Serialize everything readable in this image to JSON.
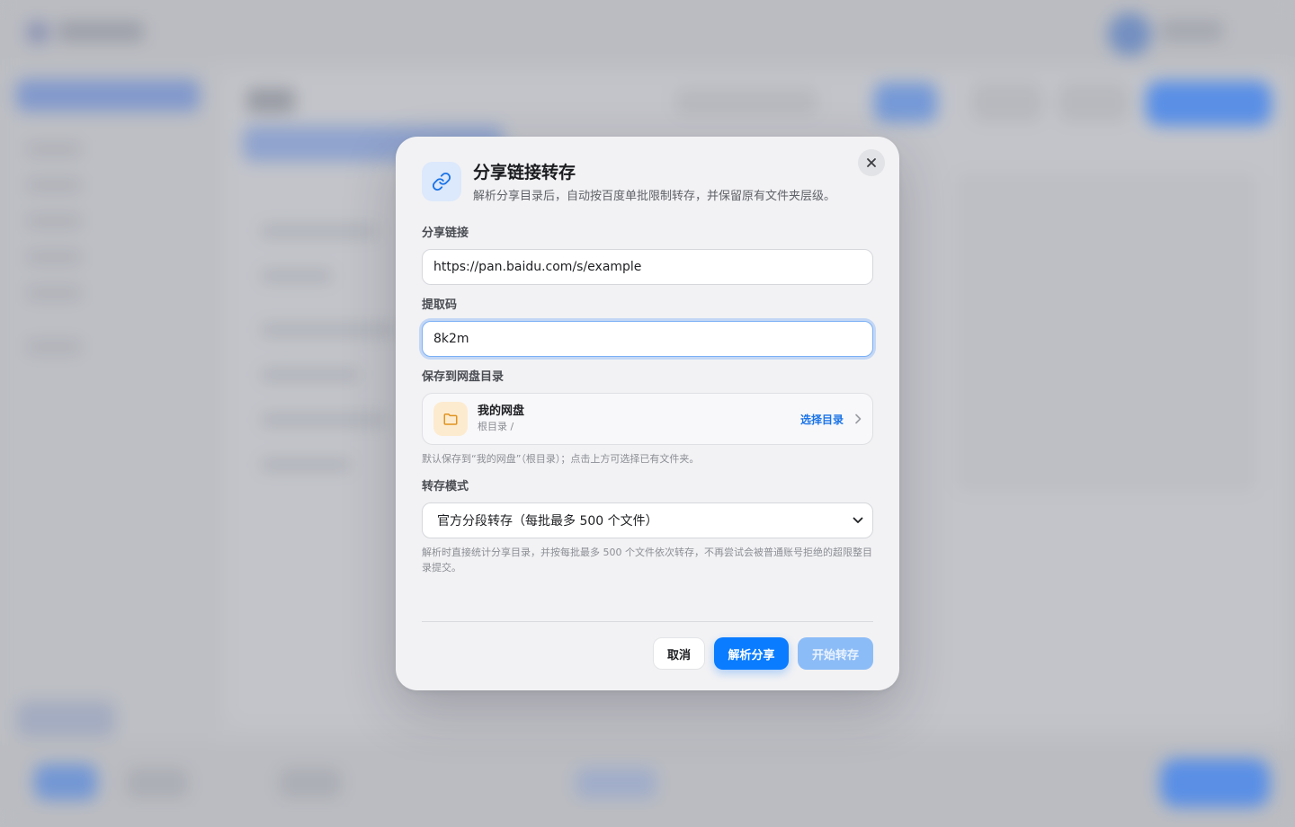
{
  "dialog": {
    "title": "分享链接转存",
    "subtitle": "解析分享目录后，自动按百度单批限制转存，并保留原有文件夹层级。",
    "fields": {
      "link_label": "分享链接",
      "link_value": "https://pan.baidu.com/s/example",
      "code_label": "提取码",
      "code_value": "8k2m",
      "dir_label": "保存到网盘目录",
      "dir_name": "我的网盘",
      "dir_path": "根目录 /",
      "dir_action": "选择目录",
      "dir_hint": "默认保存到“我的网盘”（根目录）；点击上方可选择已有文件夹。",
      "mode_label": "转存模式",
      "mode_value": "官方分段转存（每批最多 500 个文件）",
      "mode_hint": "解析时直接统计分享目录，并按每批最多 500 个文件依次转存，不再尝试会被普通账号拒绝的超限整目录提交。"
    },
    "buttons": {
      "cancel": "取消",
      "parse": "解析分享",
      "start": "开始转存"
    }
  },
  "icons": {
    "header": "link-icon",
    "close": "close-icon",
    "folder": "folder-icon",
    "chevron": "chevron-right-icon",
    "select": "chevron-down-icon"
  },
  "colors": {
    "accent": "#0a7cff",
    "accent_disabled": "#8cbcf7",
    "focus_ring": "#7cb0f5",
    "folder_bg": "#fdebd0",
    "folder_stroke": "#e0931f"
  }
}
